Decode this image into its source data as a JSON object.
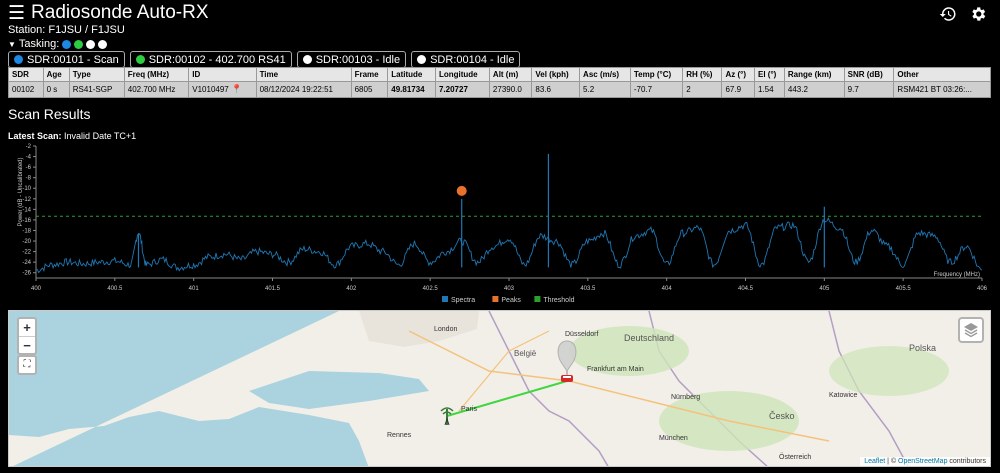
{
  "app": {
    "title": "Radiosonde Auto-RX",
    "station": "Station: F1JSU / F1JSU",
    "tasking_label": "Tasking:"
  },
  "tasking_dots": [
    "#1e88e5",
    "#2ecc40",
    "#ffffff",
    "#ffffff"
  ],
  "sdrs": [
    {
      "label": "SDR:00101 - Scan",
      "color": "#1e88e5"
    },
    {
      "label": "SDR:00102 - 402.700 RS41",
      "color": "#2ecc40"
    },
    {
      "label": "SDR:00103 - Idle",
      "color": "#ffffff"
    },
    {
      "label": "SDR:00104 - Idle",
      "color": "#ffffff"
    }
  ],
  "table": {
    "headers": [
      "SDR",
      "Age",
      "Type",
      "Freq (MHz)",
      "ID",
      "Time",
      "Frame",
      "Latitude",
      "Longitude",
      "Alt (m)",
      "Vel (kph)",
      "Asc (m/s)",
      "Temp (°C)",
      "RH (%)",
      "Az (°)",
      "El (°)",
      "Range (km)",
      "SNR (dB)",
      "Other"
    ],
    "row": [
      "00102",
      "0 s",
      "RS41-SGP",
      "402.700 MHz",
      "V1010497",
      "08/12/2024 19:22:51",
      "6805",
      "49.81734",
      "7.20727",
      "27390.0",
      "83.6",
      "5.2",
      "-70.7",
      "2",
      "67.9",
      "1.54",
      "443.2",
      "9.7",
      "RSM421 BT 03:26:..."
    ]
  },
  "scan": {
    "title": "Scan Results",
    "latest_label": "Latest Scan:",
    "latest_value": "Invalid Date TC+1"
  },
  "chart_data": {
    "type": "line",
    "xlabel": "Frequency (MHz)",
    "ylabel": "Power (dB - Uncalibrated)",
    "xlim": [
      400,
      406
    ],
    "ylim": [
      -27,
      -2
    ],
    "x_ticks": [
      "400",
      "400.5",
      "401",
      "401.5",
      "402",
      "402.5",
      "403",
      "403.5",
      "404",
      "404.5",
      "405",
      "405.5",
      "406"
    ],
    "y_ticks": [
      "-2",
      "-4",
      "-6",
      "-8",
      "-10",
      "-12",
      "-14",
      "-16",
      "-18",
      "-20",
      "-22",
      "-24",
      "-26"
    ],
    "threshold": -15.3,
    "series": [
      {
        "name": "Spectra",
        "color": "#1f77b4",
        "x": [
          400.0,
          400.1,
          400.2,
          400.3,
          400.4,
          400.5,
          400.6,
          400.65,
          400.7,
          400.8,
          400.9,
          401.0,
          401.1,
          401.2,
          401.3,
          401.4,
          401.5,
          401.6,
          401.7,
          401.8,
          401.9,
          402.0,
          402.1,
          402.2,
          402.3,
          402.4,
          402.5,
          402.6,
          402.7,
          402.8,
          402.9,
          403.0,
          403.1,
          403.2,
          403.3,
          403.4,
          403.5,
          403.6,
          403.7,
          403.8,
          403.9,
          404.0,
          404.1,
          404.2,
          404.3,
          404.4,
          404.5,
          404.6,
          404.7,
          404.8,
          404.9,
          405.0,
          405.1,
          405.2,
          405.3,
          405.4,
          405.5,
          405.6,
          405.7,
          405.8,
          405.9,
          406.0
        ],
        "y": [
          -25.5,
          -24.5,
          -24.0,
          -24.3,
          -24.0,
          -23.8,
          -24.5,
          -18.5,
          -24.5,
          -23.5,
          -25.0,
          -24.5,
          -23.0,
          -22.5,
          -23.5,
          -22.0,
          -22.5,
          -24.0,
          -21.5,
          -22.0,
          -24.5,
          -21.0,
          -20.5,
          -22.0,
          -24.5,
          -20.5,
          -24.0,
          -22.0,
          -20.0,
          -24.0,
          -21.0,
          -19.5,
          -24.5,
          -19.0,
          -20.0,
          -24.5,
          -20.0,
          -18.5,
          -24.5,
          -19.0,
          -18.0,
          -24.5,
          -18.5,
          -17.5,
          -24.5,
          -18.0,
          -17.0,
          -24.5,
          -17.5,
          -17.0,
          -24.0,
          -16.0,
          -17.5,
          -24.0,
          -18.0,
          -21.0,
          -24.5,
          -18.5,
          -19.0,
          -24.0,
          -21.0,
          -25.5
        ]
      },
      {
        "name": "Peaks",
        "color": "#e8712c",
        "x": [
          402.7
        ],
        "y": [
          -10.5
        ]
      },
      {
        "name": "Threshold",
        "color": "#2ca02c"
      }
    ],
    "spikes": [
      {
        "x": 400.65,
        "y": -18.5
      },
      {
        "x": 402.7,
        "y": -12.0
      },
      {
        "x": 403.25,
        "y": -3.5
      },
      {
        "x": 405.0,
        "y": -13.5
      }
    ]
  },
  "map": {
    "zoom_in": "+",
    "zoom_out": "−",
    "attribution_prefix": "Leaflet",
    "attribution_mid": " | © ",
    "attribution_link": "OpenStreetMap",
    "attribution_suffix": " contributors",
    "labels": [
      "London",
      "Düsseldorf",
      "Frankfurt am Main",
      "Paris",
      "Rennes",
      "Nürnberg",
      "Katowice",
      "Österreich",
      "München",
      "Deutschland",
      "Polska",
      "Česko",
      "België"
    ]
  }
}
